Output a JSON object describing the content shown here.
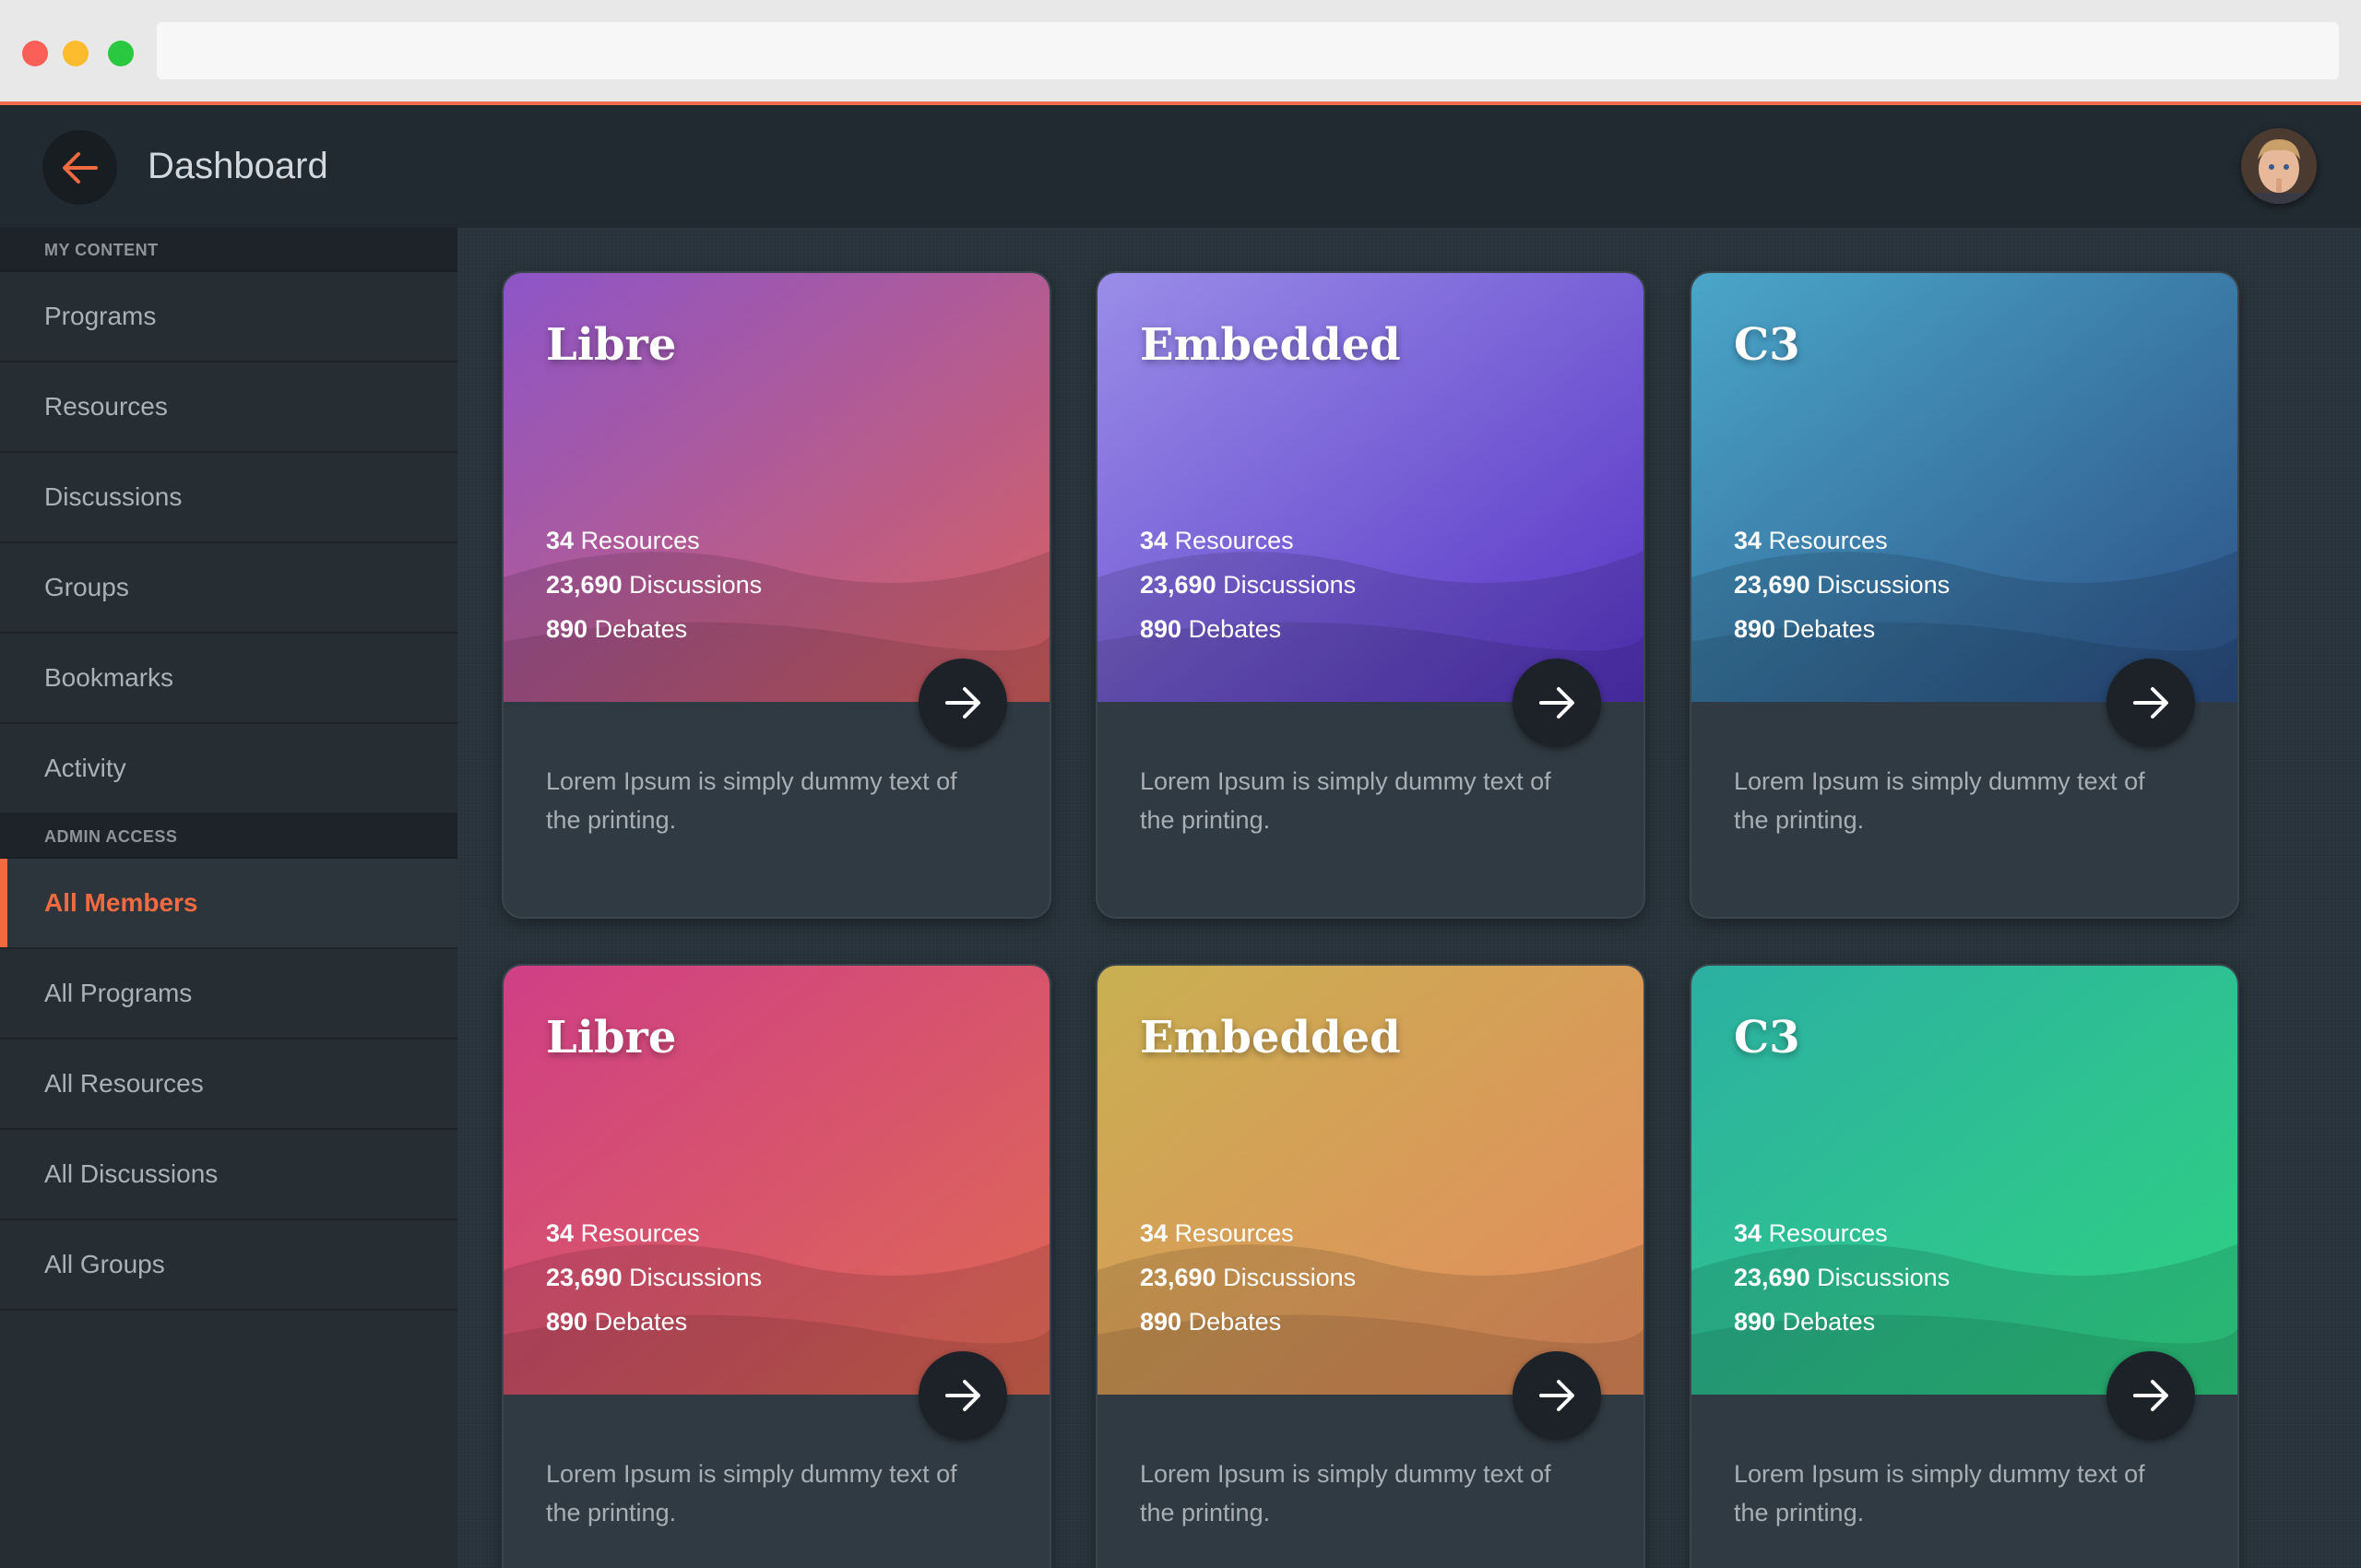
{
  "header": {
    "title": "Dashboard",
    "back_icon": "arrow-left-icon",
    "accent": "#f26a40"
  },
  "sidebar": {
    "sections": [
      {
        "heading": "MY CONTENT",
        "items": [
          {
            "label": "Programs",
            "active": false
          },
          {
            "label": "Resources",
            "active": false
          },
          {
            "label": "Discussions",
            "active": false
          },
          {
            "label": "Groups",
            "active": false
          },
          {
            "label": "Bookmarks",
            "active": false
          },
          {
            "label": "Activity",
            "active": false
          }
        ]
      },
      {
        "heading": "ADMIN ACCESS",
        "items": [
          {
            "label": "All Members",
            "active": true
          },
          {
            "label": "All Programs",
            "active": false
          },
          {
            "label": "All Resources",
            "active": false
          },
          {
            "label": "All Discussions",
            "active": false
          },
          {
            "label": "All Groups",
            "active": false
          }
        ]
      }
    ]
  },
  "cards": [
    {
      "title": "Libre",
      "resources_count": "34",
      "resources_label": "Resources",
      "discussions_count": "23,690",
      "discussions_label": "Discussions",
      "debates_count": "890",
      "debates_label": "Debates",
      "description": "Lorem Ipsum is simply dummy text of the printing.",
      "gradient": [
        "#8d55c8",
        "#d8615f"
      ]
    },
    {
      "title": "Embedded",
      "resources_count": "34",
      "resources_label": "Resources",
      "discussions_count": "23,690",
      "discussions_label": "Discussions",
      "debates_count": "890",
      "debates_label": "Debates",
      "description": "Lorem Ipsum is simply dummy text of the printing.",
      "gradient": [
        "#9a8de8",
        "#5533c4"
      ]
    },
    {
      "title": "C3",
      "resources_count": "34",
      "resources_label": "Resources",
      "discussions_count": "23,690",
      "discussions_label": "Discussions",
      "debates_count": "890",
      "debates_label": "Debates",
      "description": "Lorem Ipsum is simply dummy text of the printing.",
      "gradient": [
        "#4aa6c9",
        "#2c4f86"
      ]
    },
    {
      "title": "Libre",
      "resources_count": "34",
      "resources_label": "Resources",
      "discussions_count": "23,690",
      "discussions_label": "Discussions",
      "debates_count": "890",
      "debates_label": "Debates",
      "description": "Lorem Ipsum is simply dummy text of the printing.",
      "gradient": [
        "#cf3f86",
        "#e06a52"
      ]
    },
    {
      "title": "Embedded",
      "resources_count": "34",
      "resources_label": "Resources",
      "discussions_count": "23,690",
      "discussions_label": "Discussions",
      "debates_count": "890",
      "debates_label": "Debates",
      "description": "Lorem Ipsum is simply dummy text of the printing.",
      "gradient": [
        "#c9b052",
        "#e58a5e"
      ]
    },
    {
      "title": "C3",
      "resources_count": "34",
      "resources_label": "Resources",
      "discussions_count": "23,690",
      "discussions_label": "Discussions",
      "debates_count": "890",
      "debates_label": "Debates",
      "description": "Lorem Ipsum is simply dummy text of the printing.",
      "gradient": [
        "#2cb0a2",
        "#2fd281"
      ]
    }
  ],
  "card_arrow_icon": "arrow-right-icon"
}
